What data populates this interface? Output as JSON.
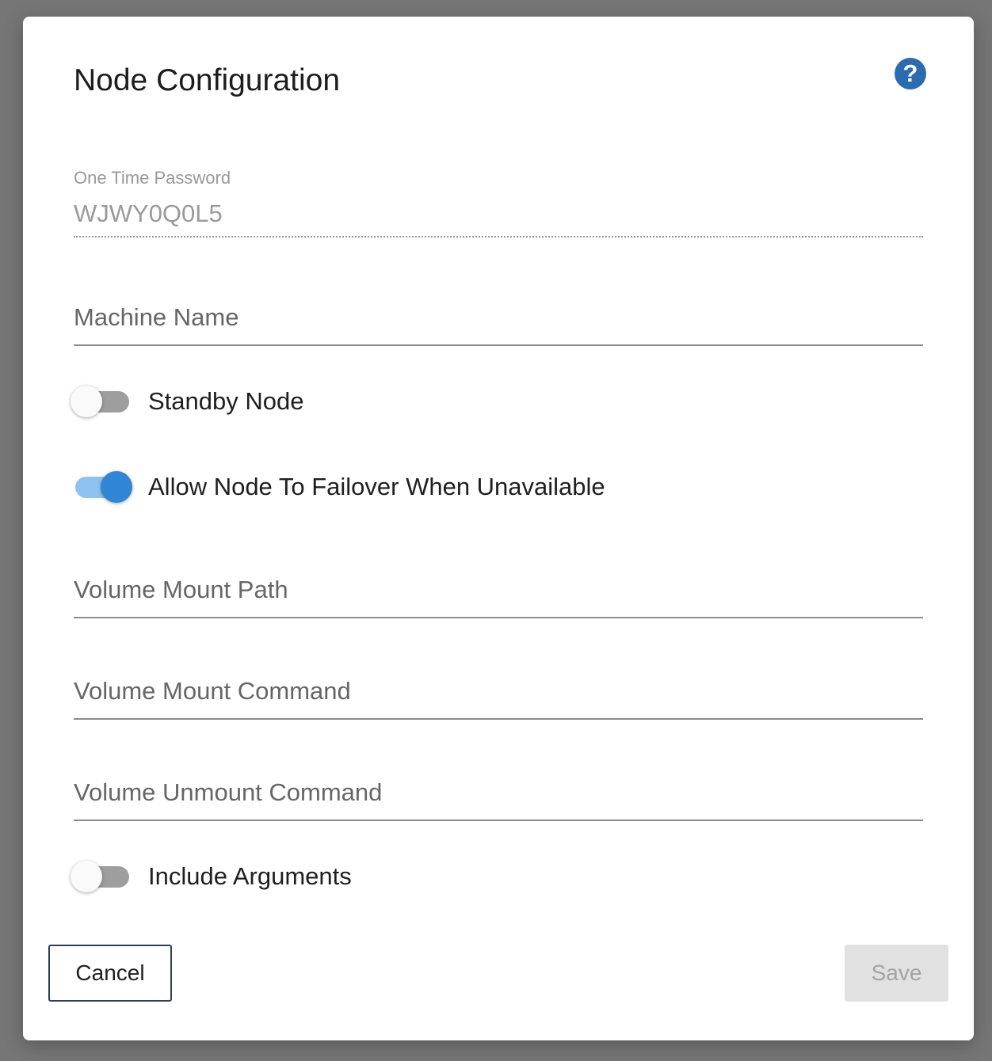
{
  "dialog": {
    "title": "Node Configuration",
    "help_icon": "question-circle-icon"
  },
  "otp": {
    "label": "One Time Password",
    "value": "WJWY0Q0L5"
  },
  "machine_name": {
    "placeholder": "Machine Name",
    "value": ""
  },
  "standby_node": {
    "label": "Standby Node",
    "checked": false
  },
  "allow_failover": {
    "label": "Allow Node To Failover When Unavailable",
    "checked": true
  },
  "volume_mount_path": {
    "placeholder": "Volume Mount Path",
    "value": ""
  },
  "volume_mount_command": {
    "placeholder": "Volume Mount Command",
    "value": ""
  },
  "volume_unmount_command": {
    "placeholder": "Volume Unmount Command",
    "value": ""
  },
  "include_arguments": {
    "label": "Include Arguments",
    "checked": false
  },
  "buttons": {
    "cancel": "Cancel",
    "save": "Save"
  },
  "colors": {
    "accent": "#2f86d6",
    "help_icon": "#2b6cb0",
    "overlay": "#767676"
  }
}
